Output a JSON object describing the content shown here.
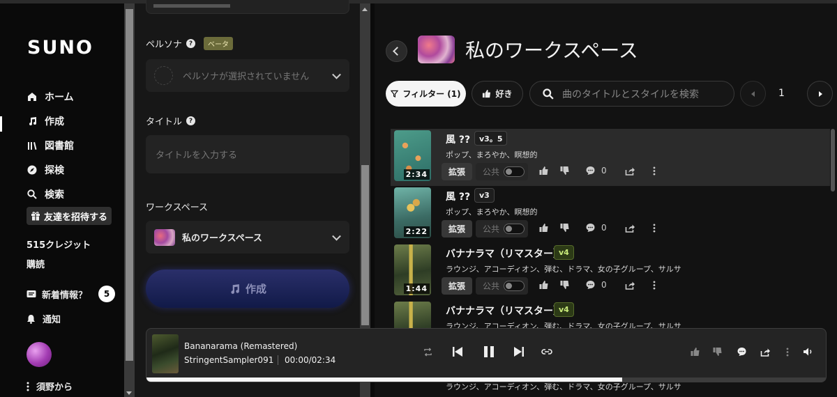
{
  "sidebar": {
    "logo": "SUNO",
    "nav": [
      {
        "label": "ホーム",
        "icon": "home-icon"
      },
      {
        "label": "作成",
        "icon": "music-note-icon"
      },
      {
        "label": "図書館",
        "icon": "library-icon"
      },
      {
        "label": "探検",
        "icon": "compass-icon"
      },
      {
        "label": "検索",
        "icon": "search-icon"
      }
    ],
    "invite_label": "友達を招待する",
    "credits": "515クレジット",
    "subscribe": "購読",
    "news_label": "新着情報？",
    "news_count": "5",
    "notify_label": "通知",
    "from_label": "須野から"
  },
  "form": {
    "persona_label": "ペルソナ",
    "beta_badge": "ベータ",
    "persona_placeholder": "ペルソナが選択されていません",
    "title_label": "タイトル",
    "title_placeholder": "タイトルを入力する",
    "workspace_label": "ワークスペース",
    "workspace_value": "私のワークスペース",
    "create_label": "作成"
  },
  "main": {
    "workspace_title": "私のワークスペース",
    "filter_label": "フィルター (1)",
    "like_label": "好き",
    "search_placeholder": "曲のタイトルとスタイルを検索",
    "page": "1",
    "extend_label": "拡張",
    "public_label": "公共",
    "songs": [
      {
        "title": "風 ??",
        "version": "v3。5",
        "tags": "ポップ、まろやか、瞑想的",
        "duration": "2:34",
        "comments": "0"
      },
      {
        "title": "風 ??",
        "version": "v3",
        "tags": "ポップ、まろやか、瞑想的",
        "duration": "2:22",
        "comments": "0"
      },
      {
        "title": "バナナラマ（リマスター）",
        "version": "v4",
        "tags": "ラウンジ、アコーディオン、弾む、ドラマ、女の子グループ、サルサ",
        "duration": "1:44",
        "comments": "0"
      },
      {
        "title": "バナナラマ（リマスター）",
        "version": "v4",
        "tags": "ラウンジ、アコーディオン、弾む、ドラマ、女の子グループ、サルサ",
        "duration": "",
        "comments": ""
      }
    ],
    "partial_tags": "ラウンジ、アコーディオン、弾む、ドラマ、女の子グループ、サルサ"
  },
  "player": {
    "title": "Bananarama (Remastered)",
    "artist": "StringentSampler091",
    "time": "00:00/02:34",
    "progress_fraction": 0.7
  }
}
